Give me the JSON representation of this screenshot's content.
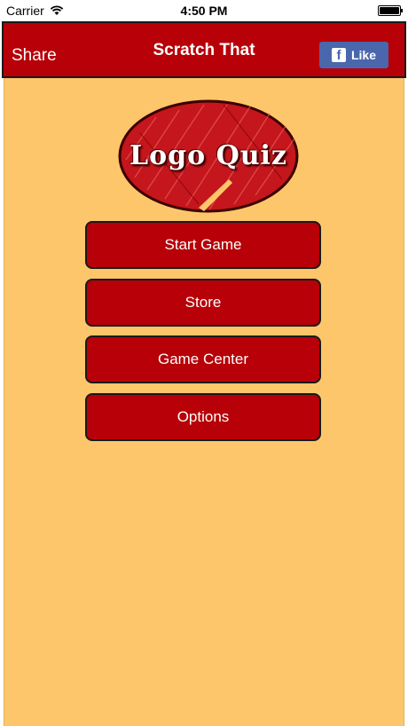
{
  "status_bar": {
    "carrier": "Carrier",
    "time": "4:50 PM",
    "wifi_icon": "wifi-icon",
    "battery_icon": "battery-icon"
  },
  "nav_bar": {
    "share_label": "Share",
    "title": "Scratch That",
    "like_label": "Like",
    "like_icon": "facebook-icon"
  },
  "logo": {
    "text": "Logo Quiz"
  },
  "menu": {
    "items": [
      {
        "label": "Start Game"
      },
      {
        "label": "Store"
      },
      {
        "label": "Game Center"
      },
      {
        "label": "Options"
      }
    ]
  },
  "colors": {
    "background": "#fdc66a",
    "accent_red": "#b70007",
    "facebook_blue": "#4a67ad"
  }
}
